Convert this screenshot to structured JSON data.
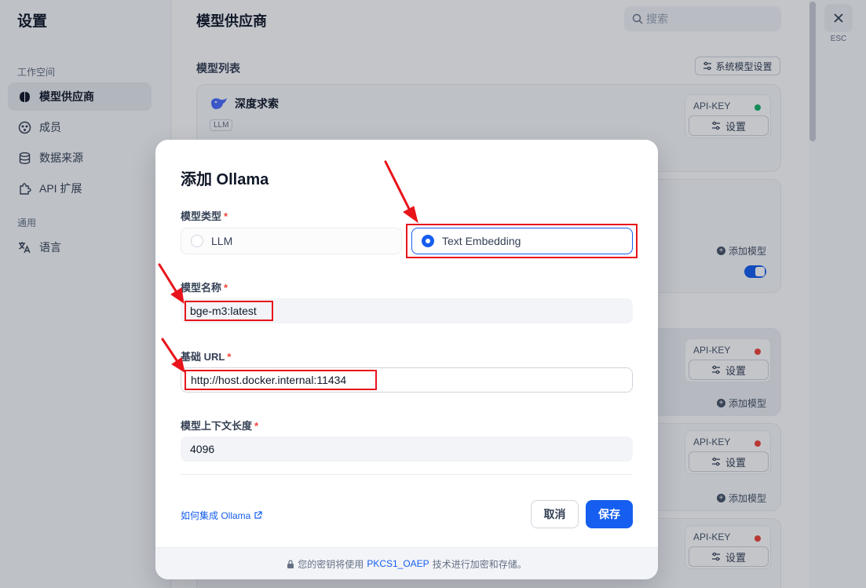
{
  "sidebar": {
    "title": "设置",
    "group_workspace": "工作空间",
    "group_general": "通用",
    "items": [
      {
        "label": "模型供应商",
        "icon": "brain-icon",
        "active": true
      },
      {
        "label": "成员",
        "icon": "members-icon"
      },
      {
        "label": "数据来源",
        "icon": "database-icon"
      },
      {
        "label": "API 扩展",
        "icon": "puzzle-icon"
      },
      {
        "label": "语言",
        "icon": "translate-icon"
      }
    ]
  },
  "main": {
    "page_title": "模型供应商",
    "search_placeholder": "搜索",
    "section_title": "模型列表",
    "system_settings_label": "系统模型设置",
    "provider_name": "深度求索",
    "provider_badge": "LLM",
    "api_key_label": "API-KEY",
    "settings_label": "设置",
    "add_model_label": "添加模型"
  },
  "close": {
    "label": "ESC"
  },
  "modal": {
    "title": "添加 Ollama",
    "model_type_label": "模型类型",
    "required_mark": "*",
    "type_options": [
      "LLM",
      "Text Embedding"
    ],
    "model_name_label": "模型名称",
    "model_name_value": "bge-m3:latest",
    "base_url_label": "基础 URL",
    "base_url_value": "http://host.docker.internal:11434",
    "context_length_label": "模型上下文长度",
    "context_length_value": "4096",
    "help_link": "如何集成 Ollama",
    "cancel_label": "取消",
    "save_label": "保存",
    "footer_prefix": "您的密钥将使用",
    "footer_link": "PKCS1_OAEP",
    "footer_suffix": "技术进行加密和存储。"
  },
  "colors": {
    "accent": "#155eef",
    "annotation": "#e8141b",
    "status_green": "#17b26a",
    "status_red": "#f04438"
  }
}
